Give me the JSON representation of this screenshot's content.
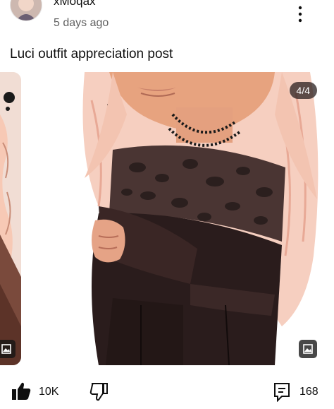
{
  "post": {
    "author": "xMoqax",
    "time": "5 days ago",
    "text": "Luci outfit appreciation post"
  },
  "carousel": {
    "counter": "4/4",
    "image_icon": "image-icon"
  },
  "actions": {
    "like_count": "10K",
    "comment_count": "168",
    "like_icon": "thumbs-up-filled-icon",
    "dislike_icon": "thumbs-down-icon",
    "comment_icon": "comment-icon",
    "menu_icon": "more-vertical-icon"
  }
}
